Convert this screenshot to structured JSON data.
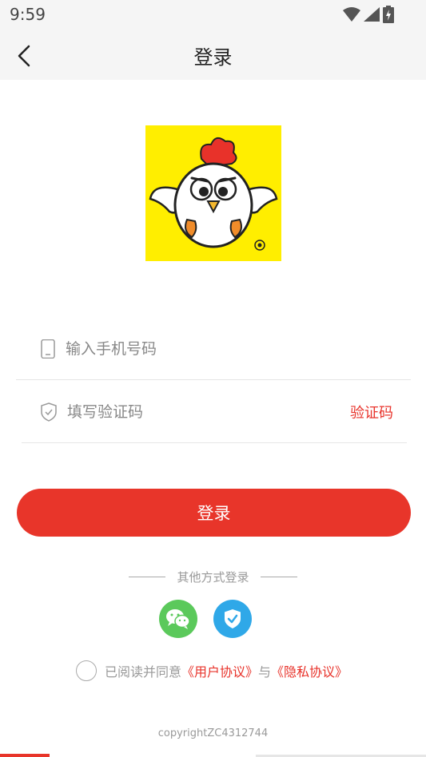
{
  "status_bar": {
    "time": "9:59"
  },
  "nav": {
    "title": "登录"
  },
  "form": {
    "phone_placeholder": "输入手机号码",
    "code_placeholder": "填写验证码",
    "get_code_label": "验证码"
  },
  "login_button_label": "登录",
  "other_login": {
    "label": "其他方式登录"
  },
  "agreement": {
    "prefix": "已阅读并同意",
    "user_agreement": "《用户协议》",
    "conjunction": "与",
    "privacy_agreement": "《隐私协议》"
  },
  "copyright": "copyrightZC4312744",
  "colors": {
    "accent": "#e8352a",
    "wechat": "#5bc95b",
    "shield": "#2fa8e8",
    "logo_bg": "#ffee00"
  },
  "icons": [
    "back-arrow-icon",
    "wifi-icon",
    "signal-icon",
    "battery-icon",
    "phone-icon",
    "shield-icon",
    "wechat-icon",
    "shield-check-icon"
  ]
}
